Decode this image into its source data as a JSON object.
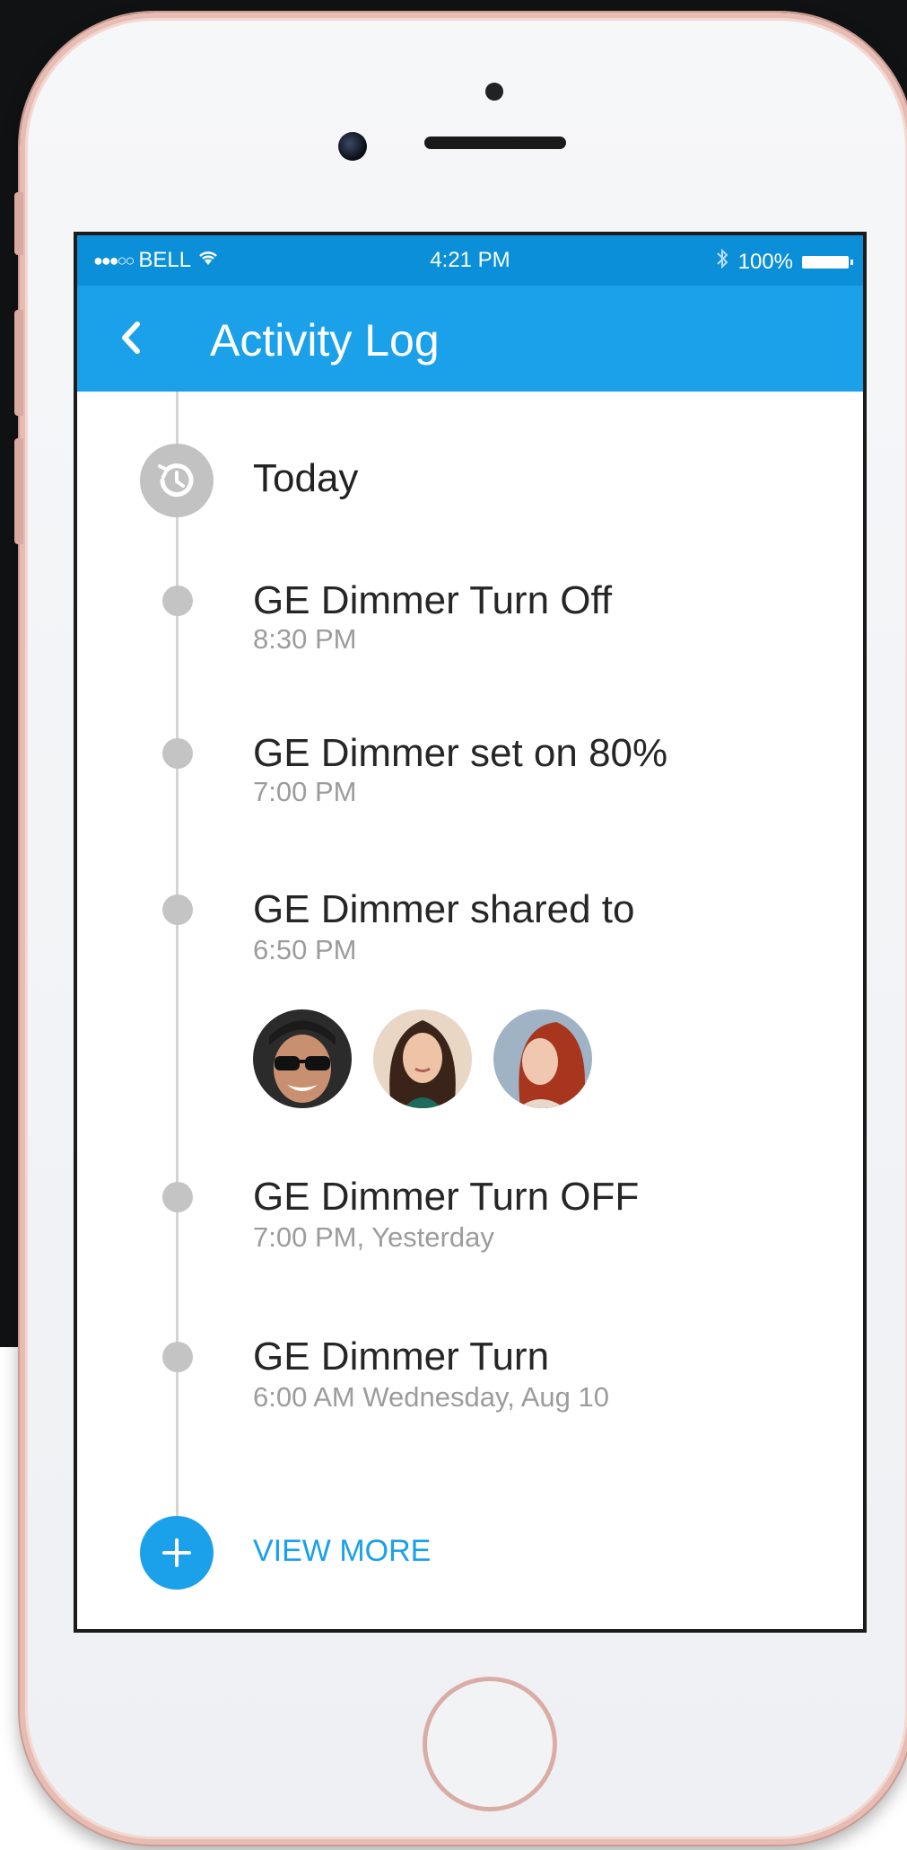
{
  "status_bar": {
    "carrier": "BELL",
    "signal_dots": "●●●○○",
    "time": "4:21 PM",
    "bluetooth_icon": "bluetooth-icon",
    "battery_percent": "100%"
  },
  "app_bar": {
    "back_icon": "chevron-left-icon",
    "title": "Activity Log"
  },
  "timeline": {
    "section_icon": "history-icon",
    "section_label": "Today",
    "entries": [
      {
        "title": "GE Dimmer Turn Off",
        "time": "8:30 PM"
      },
      {
        "title": "GE Dimmer set on 80%",
        "time": "7:00 PM"
      },
      {
        "title": "GE Dimmer shared to",
        "time": "6:50 PM",
        "shared_with": [
          "avatar-man-sunglasses",
          "avatar-woman-dark-hair",
          "avatar-woman-red-hair"
        ]
      },
      {
        "title": "GE Dimmer Turn OFF",
        "time": "7:00 PM, Yesterday"
      },
      {
        "title": "GE Dimmer Turn",
        "time": "6:00 AM Wednesday, Aug 10"
      }
    ]
  },
  "footer": {
    "view_more_icon": "plus-icon",
    "view_more_label": "VIEW MORE"
  },
  "colors": {
    "accent": "#1aa1ea",
    "status_bar": "#0a8fd8",
    "timeline": "#c4c4c4",
    "phone_frame": "#e6bcb3"
  }
}
